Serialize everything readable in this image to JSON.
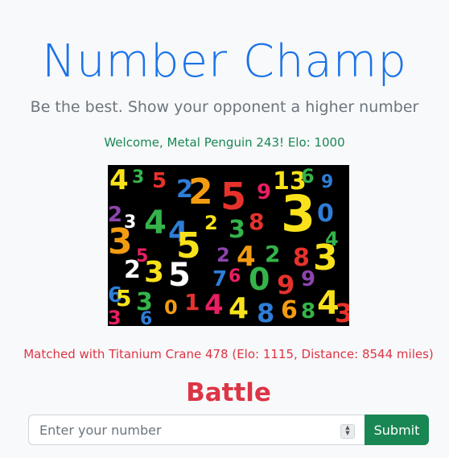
{
  "header": {
    "title": "Number Champ",
    "subtitle": "Be the best. Show your opponent a higher number"
  },
  "welcome": "Welcome, Metal Penguin 243! Elo: 1000",
  "image": {
    "icon": "colorful-numbers-image",
    "colors": [
      "#f9e21b",
      "#e7322c",
      "#2e7dd7",
      "#34b44a",
      "#8e44ad",
      "#f39c12",
      "#ffffff",
      "#e91e63"
    ]
  },
  "match_text": "Matched with Titanium Crane 478 (Elo: 1115, Distance: 8544 miles)",
  "battle": {
    "heading": "Battle",
    "input_placeholder": "Enter your number",
    "submit_label": "Submit"
  },
  "theme": {
    "title_color": "#1a73e8",
    "success_color": "#198754",
    "danger_color": "#dc3545"
  }
}
